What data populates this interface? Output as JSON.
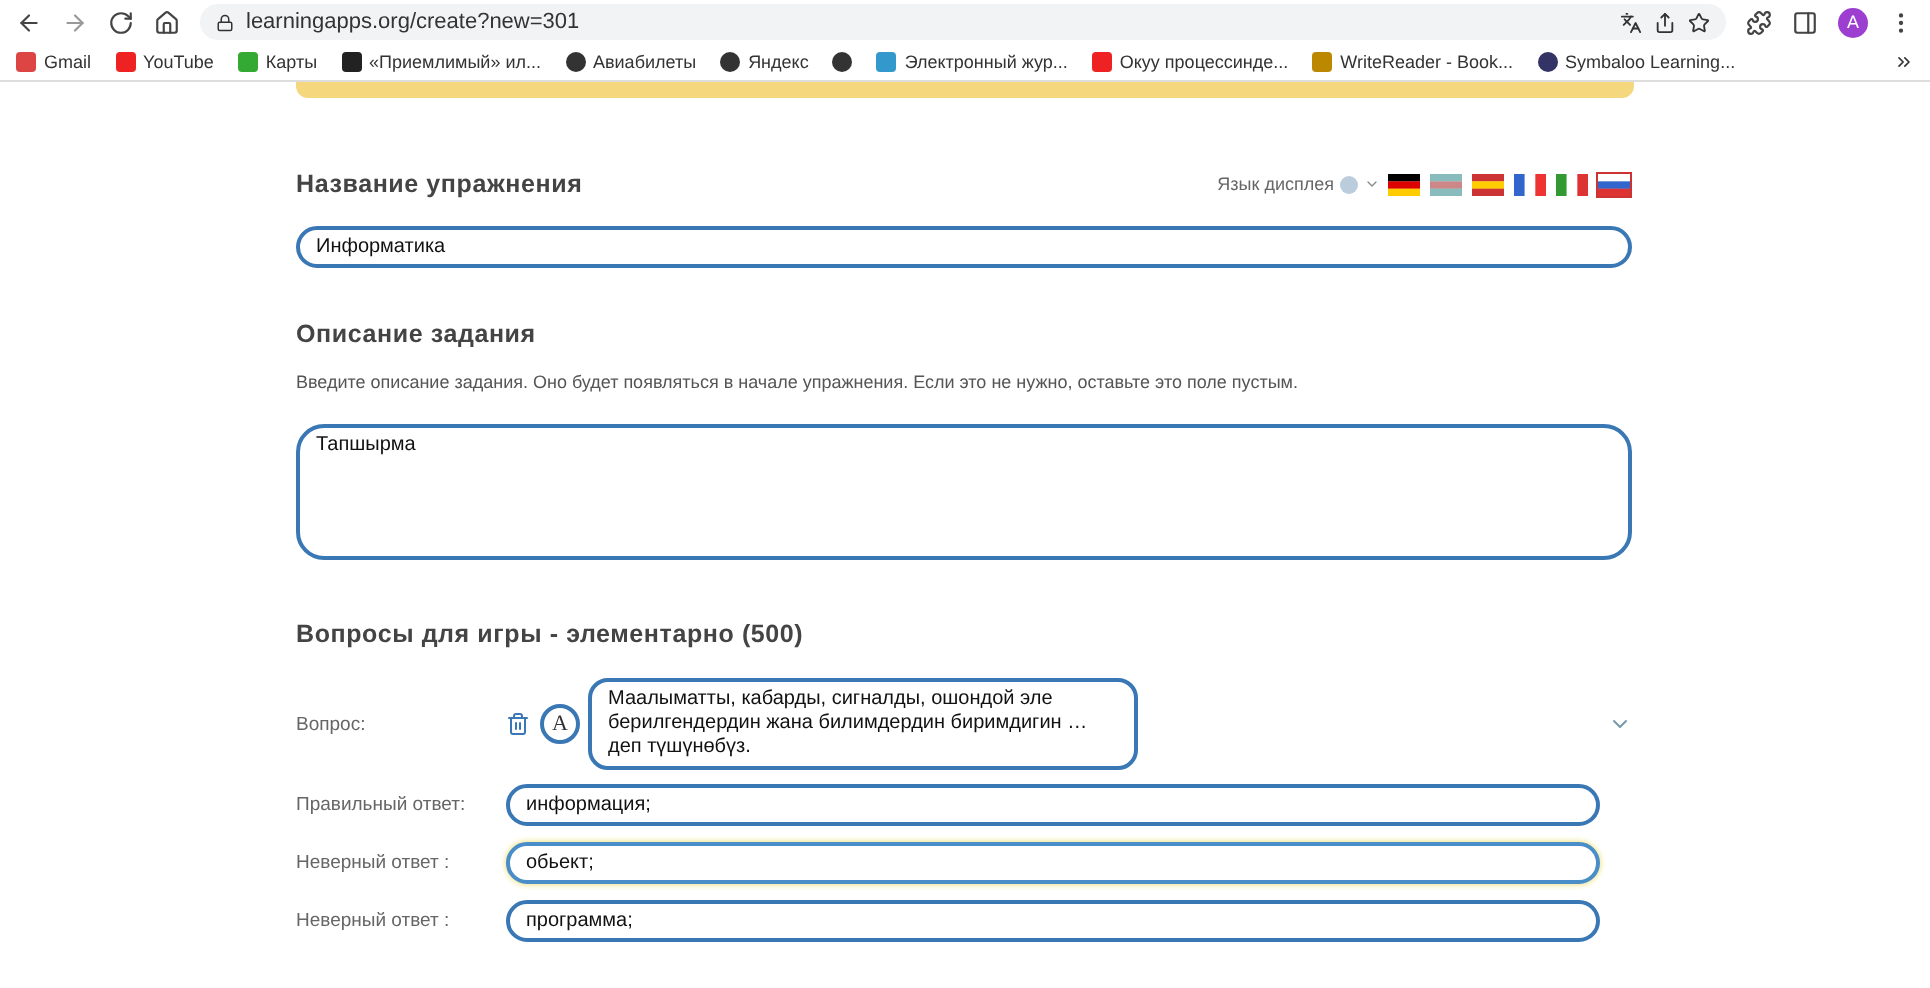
{
  "browser": {
    "url": "learningapps.org/create?new=301",
    "avatar": "A"
  },
  "bookmarks": [
    {
      "label": "Gmail",
      "kind": "mail"
    },
    {
      "label": "YouTube",
      "kind": "video"
    },
    {
      "label": "Карты",
      "kind": "pin"
    },
    {
      "label": "«Приемлимый» ил...",
      "kind": "square"
    },
    {
      "label": "Авиабилеты",
      "kind": "globe"
    },
    {
      "label": "Яндекс",
      "kind": "globe"
    },
    {
      "kind": "globe"
    },
    {
      "label": "Электронный жур...",
      "kind": "star"
    },
    {
      "label": "Окуу процессинде...",
      "kind": "d"
    },
    {
      "label": "WriteReader - Book...",
      "kind": "book"
    },
    {
      "label": "Symbaloo Learning...",
      "kind": "circle"
    }
  ],
  "title_section": {
    "heading": "Название упражнения",
    "language_label": "Язык дисплея",
    "flags": [
      {
        "kind": "de",
        "selected": false
      },
      {
        "kind": "uk",
        "selected": false
      },
      {
        "kind": "es",
        "selected": false
      },
      {
        "kind": "fr",
        "selected": false
      },
      {
        "kind": "it",
        "selected": false
      },
      {
        "kind": "ru",
        "selected": true
      }
    ],
    "value": "Информатика"
  },
  "description_section": {
    "heading": "Описание задания",
    "hint": "Введите описание задания. Оно будет появляться в начале упражнения. Если это не нужно, оставьте это поле пустым.",
    "value": "Тапшырма"
  },
  "questions_section": {
    "heading": "Вопросы для игры - элементарно (500)",
    "question_label": "Вопрос:",
    "font_button": "A",
    "question": "Маалыматты, кабарды, сигналды, ошондой эле берилгендердин жана билимдердин биримдигин … деп түшүнөбүз.",
    "answers": [
      {
        "label": "Правильный ответ:",
        "value": "информация;",
        "focused": false
      },
      {
        "label": "Неверный ответ :",
        "value": "обьект;",
        "focused": true
      },
      {
        "label": "Неверный ответ :",
        "value": "программа;",
        "focused": false
      }
    ]
  }
}
